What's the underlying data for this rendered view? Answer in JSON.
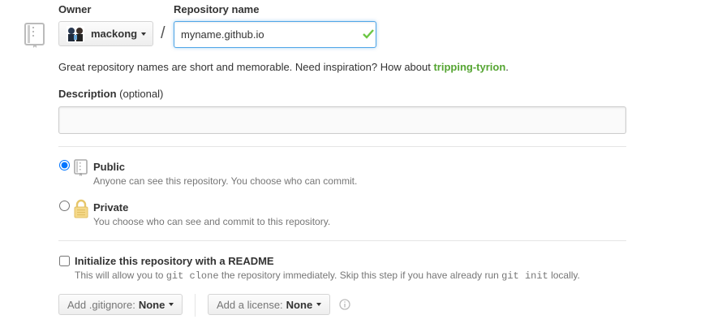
{
  "owner": {
    "label": "Owner",
    "name": "mackong",
    "icon": "caret-down-icon"
  },
  "repository": {
    "label": "Repository name",
    "separator": "/",
    "value": "myname.github.io",
    "valid": true
  },
  "suggestion": {
    "prefix": "Great repository names are short and memorable. Need inspiration? How about ",
    "name": "tripping-tyrion",
    "suffix": "."
  },
  "description": {
    "label": "Description",
    "optional": "(optional)",
    "value": ""
  },
  "visibility": {
    "selected": "public",
    "options": [
      {
        "id": "public",
        "title": "Public",
        "note": "Anyone can see this repository. You choose who can commit.",
        "icon": "repo-icon"
      },
      {
        "id": "private",
        "title": "Private",
        "note": "You choose who can see and commit to this repository.",
        "icon": "lock-icon"
      }
    ]
  },
  "readme": {
    "checked": false,
    "title": "Initialize this repository with a README",
    "note_before": "This will allow you to ",
    "code1": "git clone",
    "note_middle": " the repository immediately. Skip this step if you have already run ",
    "code2": "git init",
    "note_after": " locally."
  },
  "gitignore": {
    "label": "Add .gitignore:",
    "value": "None"
  },
  "license": {
    "label": "Add a license:",
    "value": "None"
  },
  "colors": {
    "accent_green": "#55a532",
    "focus_blue": "#51a7e8",
    "check_green": "#6cc644"
  }
}
